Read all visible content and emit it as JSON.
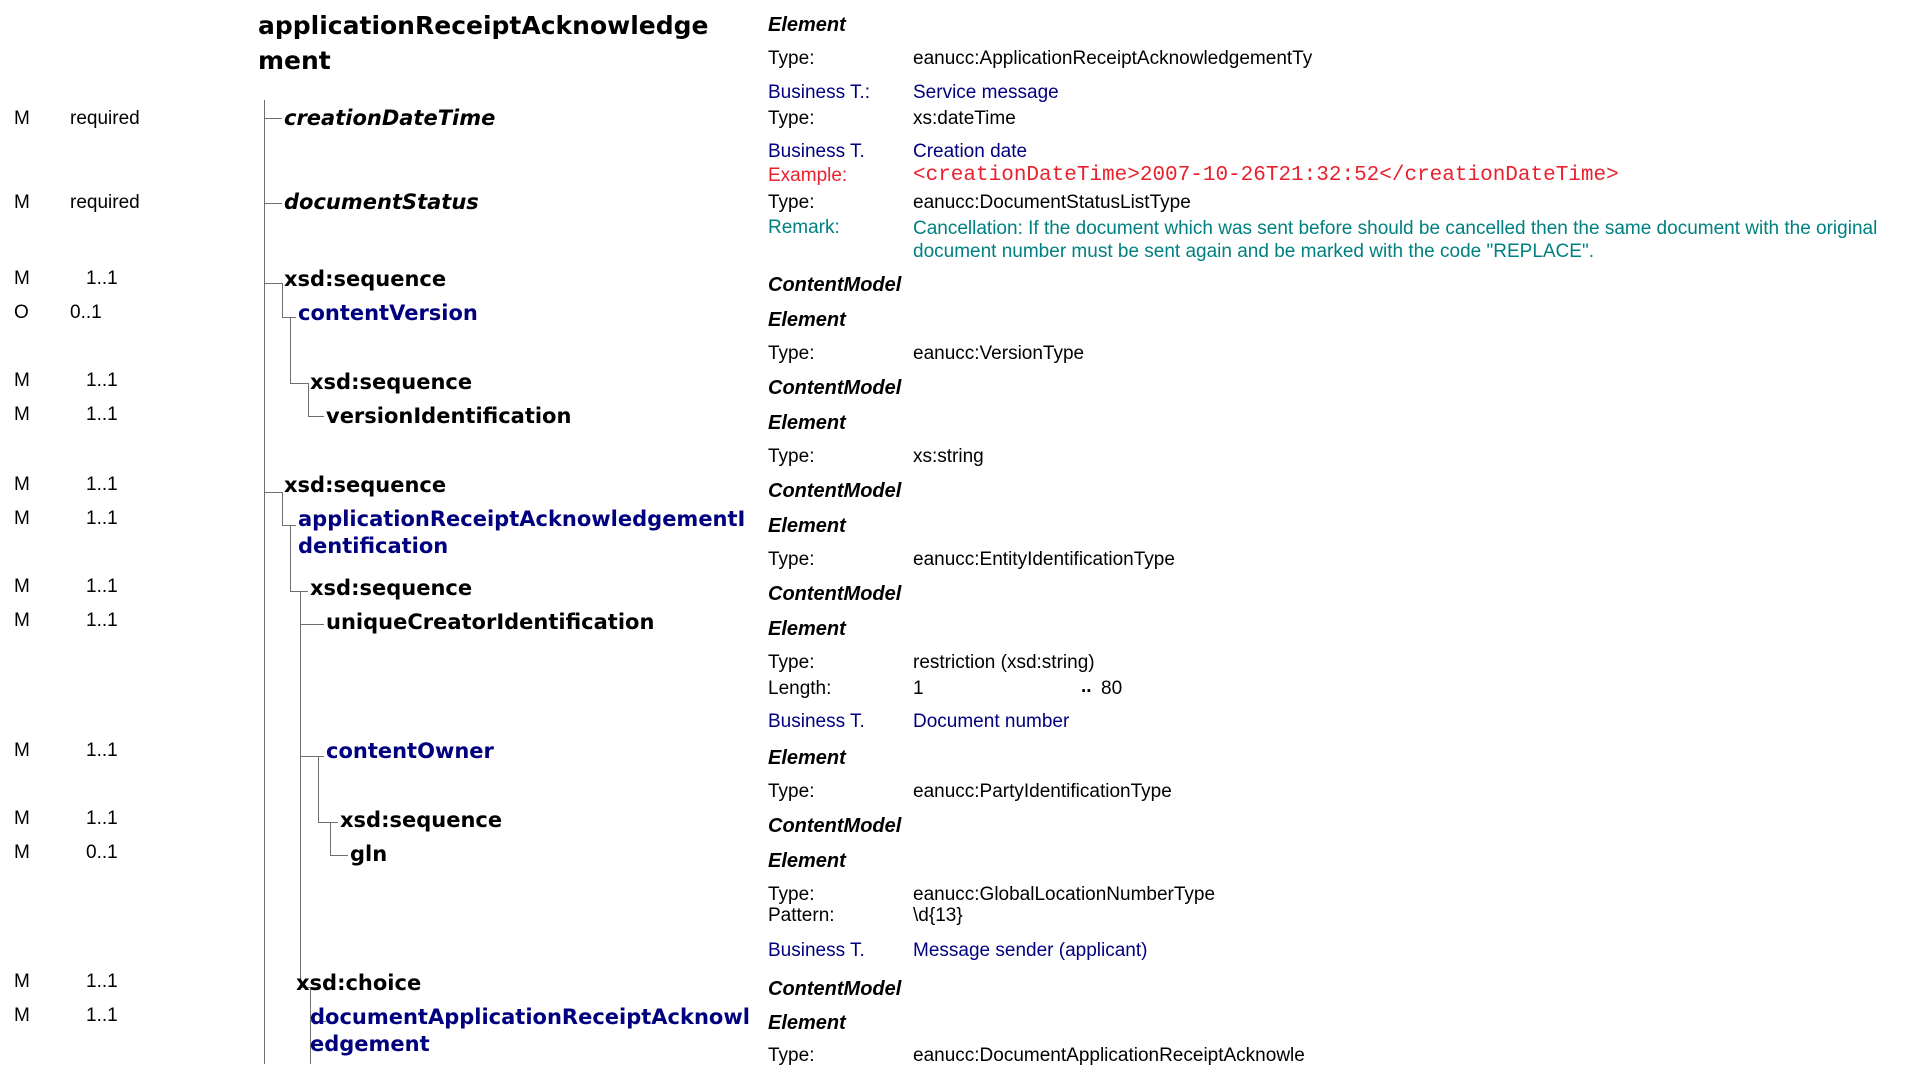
{
  "title": "applicationReceiptAcknowledgement",
  "title_line1": "applicationReceiptAcknowledge",
  "title_line2": "ment",
  "labels": {
    "element": "Element",
    "content_model": "ContentModel",
    "type": "Type:",
    "business_t_colon": "Business T.:",
    "business_t": "Business T.",
    "example": "Example:",
    "remark": "Remark:",
    "length": "Length:",
    "pattern": "Pattern:"
  },
  "root": {
    "type": "eanucc:ApplicationReceiptAcknowledgementTy",
    "business": "Service message"
  },
  "rows": [
    {
      "use": "M",
      "card": "required",
      "name": "creationDateTime"
    },
    {
      "use": "M",
      "card": "required",
      "name": "documentStatus"
    },
    {
      "use": "M",
      "card": "1..1",
      "name": "xsd:sequence"
    },
    {
      "use": "O",
      "card": "0..1",
      "name": "contentVersion"
    },
    {
      "use": "M",
      "card": "1..1",
      "name": "xsd:sequence"
    },
    {
      "use": "M",
      "card": "1..1",
      "name": "versionIdentification"
    },
    {
      "use": "M",
      "card": "1..1",
      "name": "xsd:sequence"
    },
    {
      "use": "M",
      "card": "1..1",
      "name_line1": "applicationReceiptAcknowledgementI",
      "name_line2": "dentification"
    },
    {
      "use": "M",
      "card": "1..1",
      "name": "xsd:sequence"
    },
    {
      "use": "M",
      "card": "1..1",
      "name": "uniqueCreatorIdentification"
    },
    {
      "use": "M",
      "card": "1..1",
      "name": "contentOwner"
    },
    {
      "use": "M",
      "card": "1..1",
      "name": "xsd:sequence"
    },
    {
      "use": "M",
      "card": "0..1",
      "name": "gln"
    },
    {
      "use": "M",
      "card": "1..1",
      "name": "xsd:choice"
    },
    {
      "use": "M",
      "card": "1..1",
      "name_line1": "documentApplicationReceiptAcknowl",
      "name_line2": "edgement"
    }
  ],
  "details": {
    "creationDateTime": {
      "type": "xs:dateTime",
      "business": "Creation date",
      "example": "<creationDateTime>2007-10-26T21:32:52</creationDateTime>"
    },
    "documentStatus": {
      "type": "eanucc:DocumentStatusListType",
      "remark": "Cancellation: If the document which was sent before should be cancelled then the same document with the original document number must be sent again and be marked with the code \"REPLACE\"."
    },
    "contentVersion": {
      "type": "eanucc:VersionType"
    },
    "versionIdentification": {
      "type": "xs:string"
    },
    "applicationReceiptAcknowledgementIdentification": {
      "type": "eanucc:EntityIdentificationType"
    },
    "uniqueCreatorIdentification": {
      "type": "restriction (xsd:string)",
      "length_min": "1",
      "length_sep": "..",
      "length_max": "80",
      "business": "Document number"
    },
    "contentOwner": {
      "type": "eanucc:PartyIdentificationType"
    },
    "gln": {
      "type": "eanucc:GlobalLocationNumberType",
      "pattern": "\\d{13}",
      "business": "Message sender (applicant)"
    },
    "documentApplicationReceiptAcknowledgement": {
      "type": "eanucc:DocumentApplicationReceiptAcknowle"
    }
  },
  "colors": {
    "navy": "#00007f",
    "red": "#e8212d",
    "teal": "#008080",
    "line": "#6e6e6e"
  }
}
